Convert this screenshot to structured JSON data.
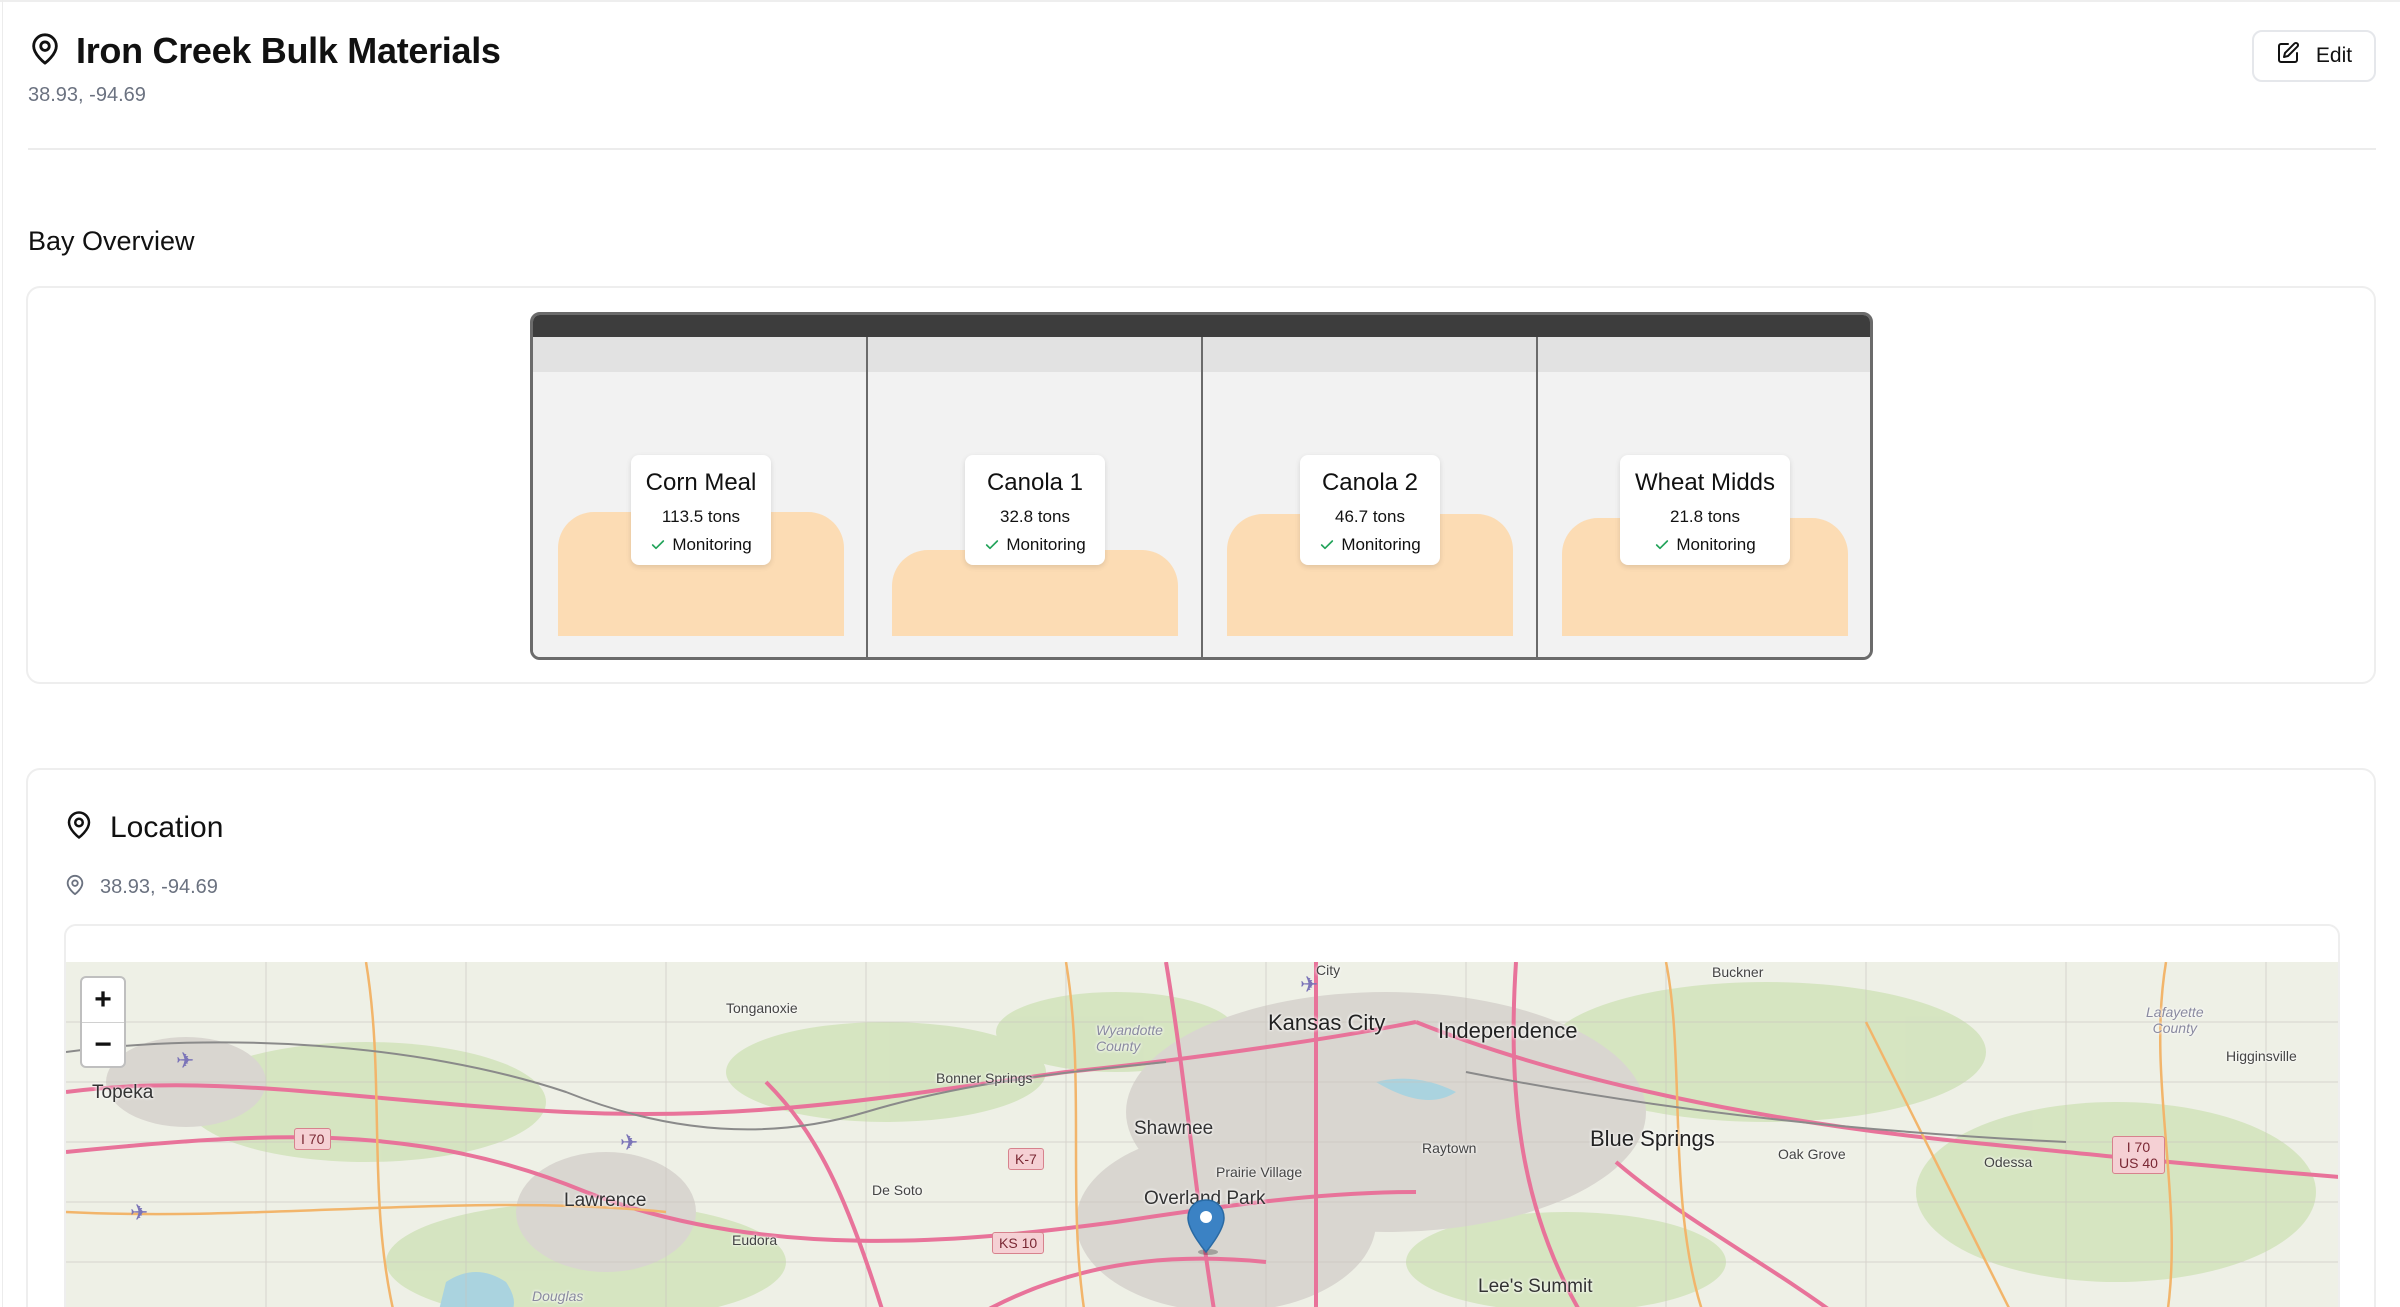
{
  "header": {
    "title": "Iron Creek Bulk Materials",
    "coordinates": "38.93, -94.69",
    "edit_label": "Edit"
  },
  "bay_overview": {
    "title": "Bay Overview",
    "bays": [
      {
        "name": "Corn Meal",
        "amount": "113.5 tons",
        "status": "Monitoring",
        "fill_level": 0.97
      },
      {
        "name": "Canola 1",
        "amount": "32.8 tons",
        "status": "Monitoring",
        "fill_level": 0.67
      },
      {
        "name": "Canola 2",
        "amount": "46.7 tons",
        "status": "Monitoring",
        "fill_level": 0.95
      },
      {
        "name": "Wheat Midds",
        "amount": "21.8 tons",
        "status": "Monitoring",
        "fill_level": 0.92
      }
    ]
  },
  "location": {
    "title": "Location",
    "coordinates": "38.93, -94.69"
  },
  "map": {
    "zoom_in": "+",
    "zoom_out": "−",
    "places": {
      "kansas_city": "Kansas City",
      "independence": "Independence",
      "topeka": "Topeka",
      "lawrence": "Lawrence",
      "shawnee": "Shawnee",
      "overland_park": "Overland Park",
      "blue_springs": "Blue Springs",
      "lees_summit": "Lee's Summit",
      "tonganoxie": "Tonganoxie",
      "bonner_springs": "Bonner Springs",
      "de_soto": "De Soto",
      "eudora": "Eudora",
      "prairie_village": "Prairie Village",
      "raytown": "Raytown",
      "oak_grove": "Oak Grove",
      "odessa": "Odessa",
      "buckner": "Buckner",
      "higginsville": "Higginsville",
      "city": "City",
      "wyandotte_county": "Wyandotte\nCounty",
      "lafayette_county": "Lafayette\nCounty",
      "douglas": "Douglas"
    },
    "shields": {
      "i70_west": "I 70",
      "k7": "K-7",
      "ks10": "KS 10",
      "i70_us40": "I 70\nUS 40"
    }
  },
  "colors": {
    "fill": "#fcdcb4",
    "bay_frame": "#6b6b6b",
    "roof": "#3d3d3d",
    "check": "#22a35a",
    "pin": "#3b82c4"
  }
}
